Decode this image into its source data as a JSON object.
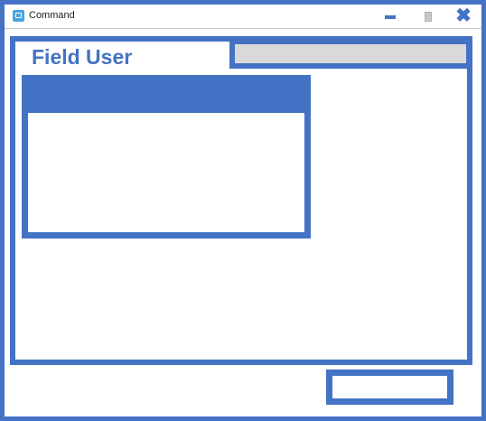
{
  "window": {
    "title": "Command",
    "close_glyph": "✖"
  },
  "form": {
    "field_label": "Field User",
    "field_value": "",
    "action_label": ""
  },
  "colors": {
    "accent": "#4472c4",
    "input_fill": "#d9d9d9"
  },
  "icons": {
    "app": "app-icon",
    "minimize": "minimize-icon",
    "maximize": "maximize-icon",
    "close": "close-icon"
  }
}
